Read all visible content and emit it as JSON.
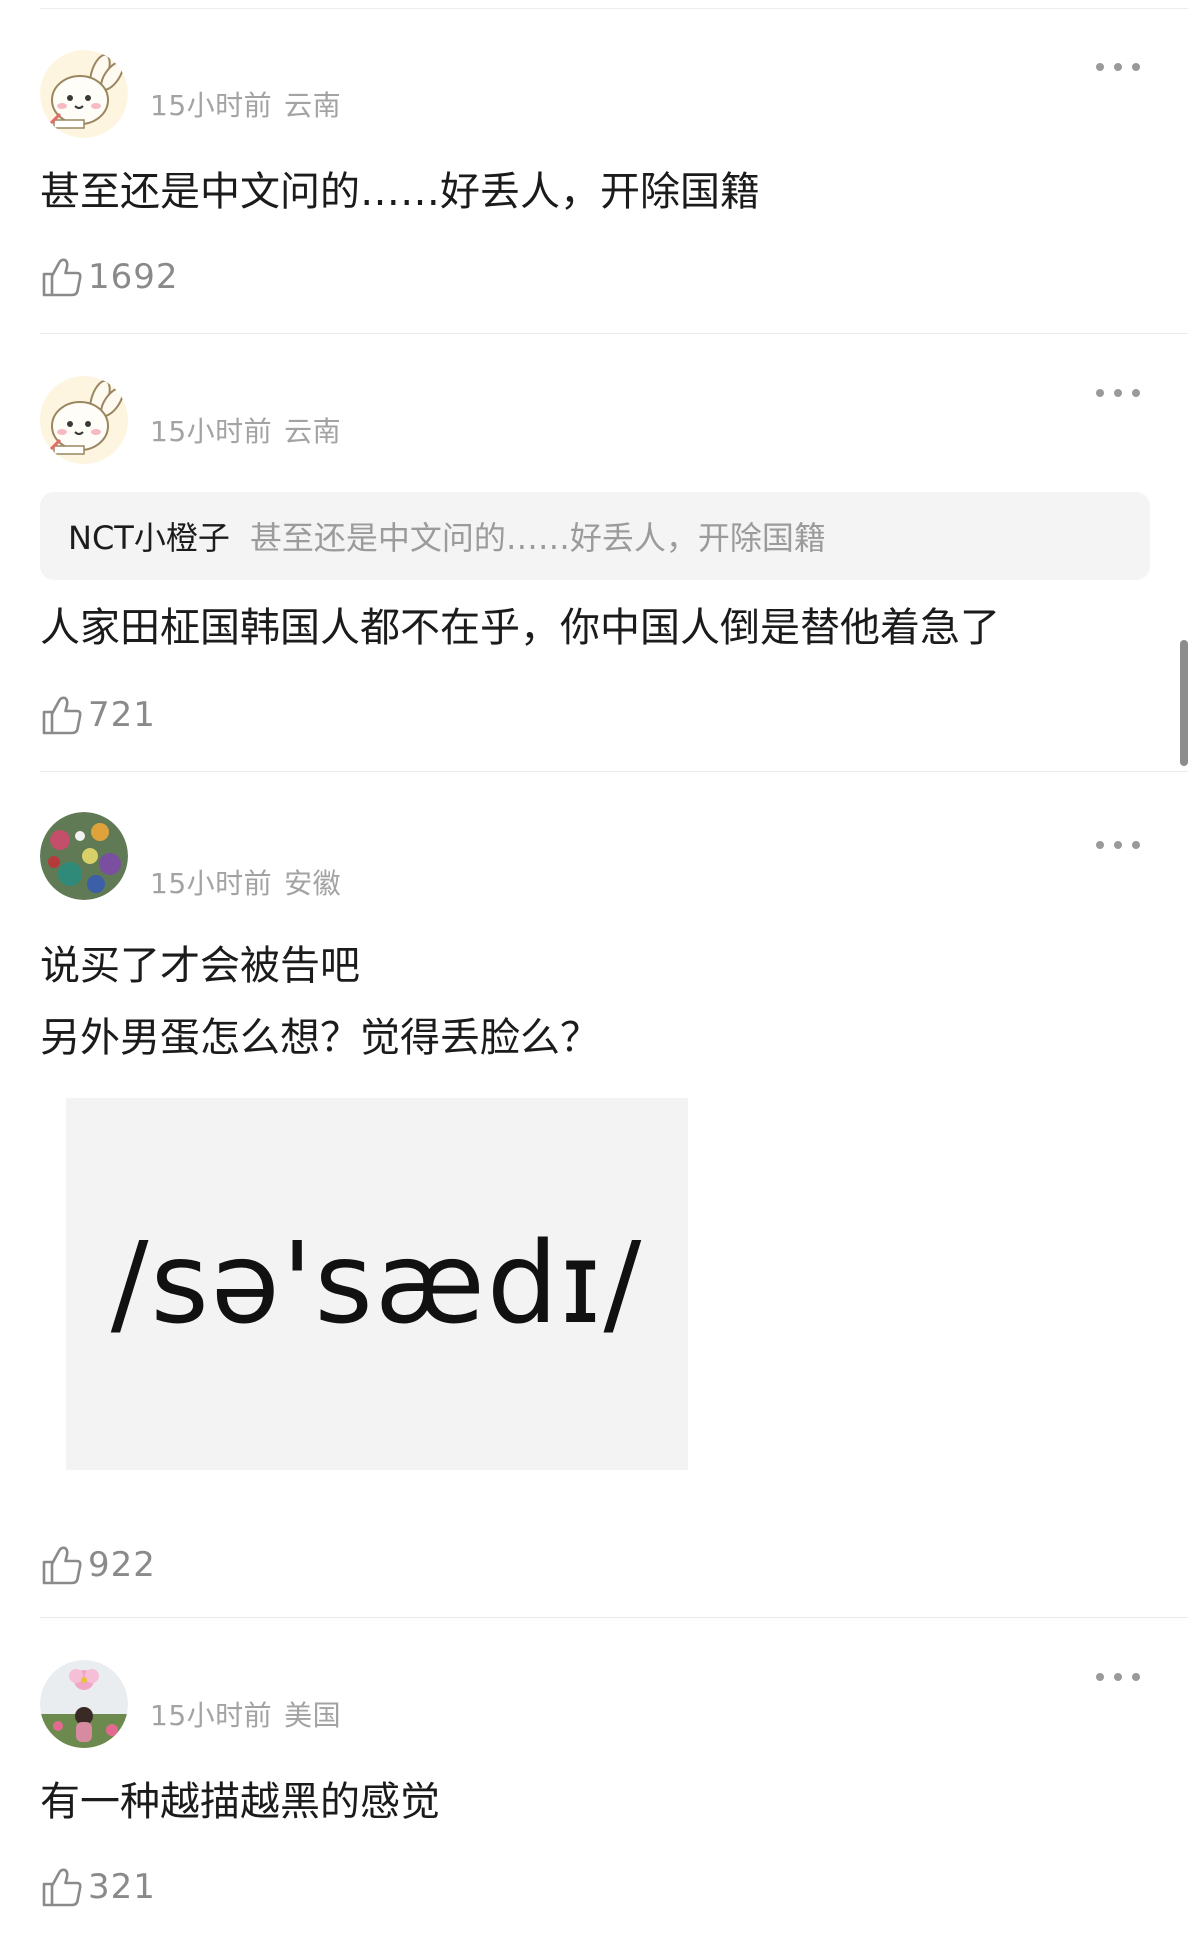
{
  "comments": [
    {
      "time": "15小时前",
      "location": "云南",
      "text": "甚至还是中文问的……好丢人，开除国籍",
      "likes": "1692",
      "avatar": "cartoon-bunny"
    },
    {
      "time": "15小时前",
      "location": "云南",
      "quote_user": "NCT小橙子",
      "quote_text": "甚至还是中文问的……好丢人，开除国籍",
      "text": "人家田柾国韩国人都不在乎，你中国人倒是替他着急了",
      "likes": "721",
      "avatar": "cartoon-bunny"
    },
    {
      "time": "15小时前",
      "location": "安徽",
      "text_line1": "说买了才会被告吧",
      "text_line2": "另外男蛋怎么想？觉得丢脸么？",
      "image_text": "/sə'sædɪ/",
      "likes": "922",
      "avatar": "photo-flowers"
    },
    {
      "time": "15小时前",
      "location": "美国",
      "text": "有一种越描越黑的感觉",
      "likes": "321",
      "avatar": "photo-pink-flower"
    }
  ],
  "icons": {
    "like": "thumbs-up-icon",
    "more": "more-dots-icon"
  },
  "colors": {
    "meta_text": "#a3a3a3",
    "quote_bg": "#f4f4f4",
    "divider": "#e9e9e9"
  }
}
